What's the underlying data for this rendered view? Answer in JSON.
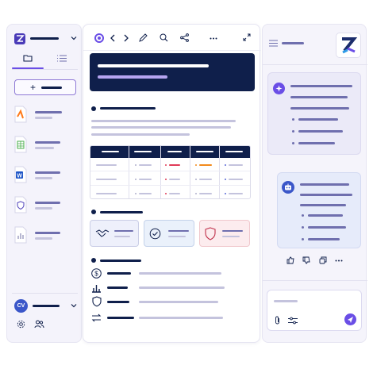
{
  "sidebar": {
    "avatar_initials": "CV",
    "files": [
      {
        "icon": "pdf-file-icon",
        "accent": "#ff7a1a"
      },
      {
        "icon": "spreadsheet-file-icon",
        "accent": "#4caf50"
      },
      {
        "icon": "word-file-icon",
        "accent": "#1f56c8"
      },
      {
        "icon": "shield-file-icon",
        "accent": "#5b4fc0"
      },
      {
        "icon": "chart-file-icon",
        "accent": "#9a9abf"
      }
    ],
    "new_button": "+"
  },
  "document": {
    "table": {
      "columns": 5,
      "rows": 3
    },
    "status_colors": [
      "#e03b58",
      "#f28a1c",
      "#5b6bd6"
    ],
    "cards": [
      {
        "icon": "handshake-icon",
        "bg": "#eef0fb"
      },
      {
        "icon": "check-circle-icon",
        "bg": "#eaf1fb"
      },
      {
        "icon": "shield-icon",
        "bg": "#fcecee"
      }
    ],
    "list_icons": [
      "dollar-icon",
      "bar-chart-icon",
      "shield-icon",
      "transfer-icon"
    ]
  },
  "assistant": {
    "accent": "#6a4ee6",
    "brand_color": "#1b2d6b"
  }
}
